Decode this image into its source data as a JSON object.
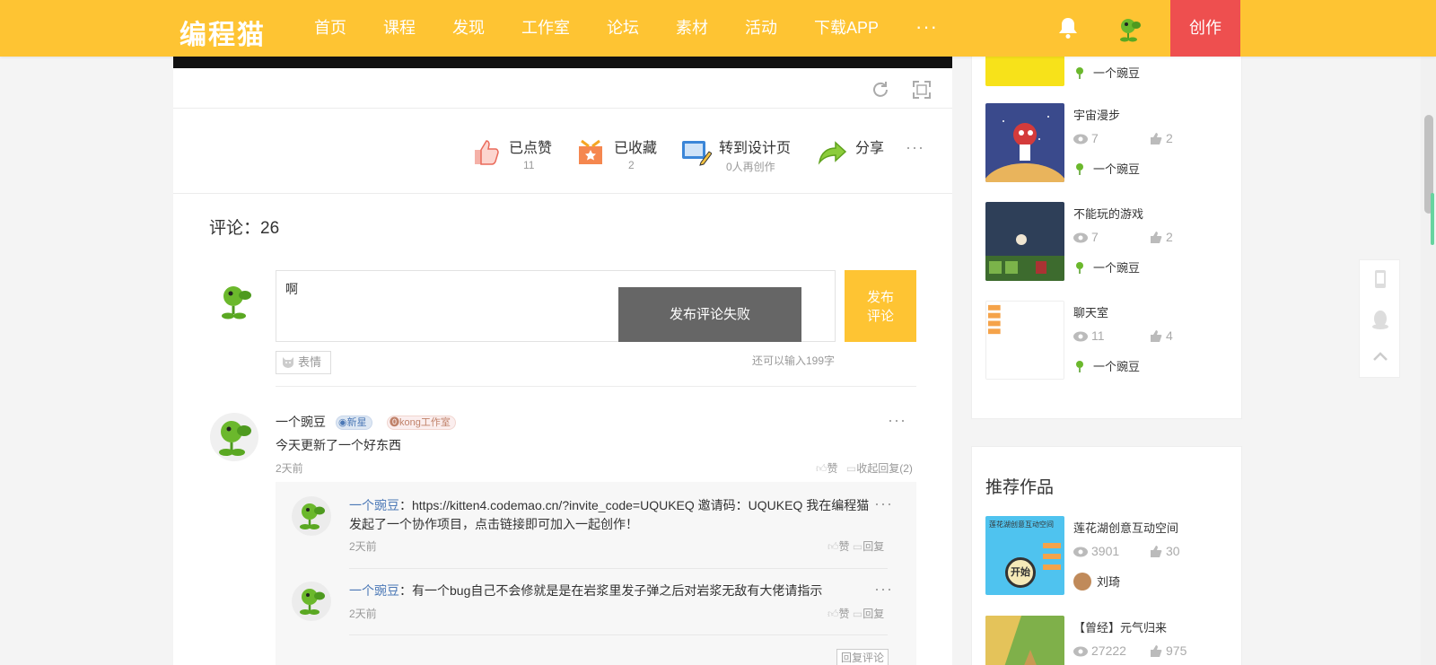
{
  "header": {
    "logo": "编程猫",
    "nav": [
      "首页",
      "课程",
      "发现",
      "工作室",
      "论坛",
      "素材",
      "活动",
      "下载APP"
    ],
    "more": "···",
    "create": "创作",
    "colors": {
      "bar": "#fec433",
      "create": "#ee4f4f"
    }
  },
  "player": {
    "refresh_icon": "refresh-icon",
    "fullscreen_icon": "fullscreen-icon"
  },
  "actions": {
    "like": {
      "label": "已点赞",
      "count": "11"
    },
    "favorite": {
      "label": "已收藏",
      "count": "2"
    },
    "design": {
      "label": "转到设计页",
      "sub": "0人再创作"
    },
    "share": {
      "label": "分享"
    },
    "more": "···"
  },
  "comments": {
    "title": "评论：26",
    "input_value": "啊",
    "publish": [
      "发布",
      "评论"
    ],
    "toast": "发布评论失败",
    "emoji": "表情",
    "counter": "还可以输入199字",
    "items": [
      {
        "name": "一个豌豆",
        "badge_level": "新星",
        "badge_studio": "kong工作室",
        "text": "今天更新了一个好东西",
        "time": "2天前",
        "like": "赞",
        "collapse": "收起回复(2)",
        "more": "···",
        "replies": [
          {
            "name": "一个豌豆",
            "text": "：https://kitten4.codemao.cn/?invite_code=UQUKEQ 邀请码：UQUKEQ 我在编程猫发起了一个协作项目，点击链接即可加入一起创作！",
            "time": "2天前",
            "like": "赞",
            "reply": "回复",
            "more": "···"
          },
          {
            "name": "一个豌豆",
            "text": "：有一个bug自己不会修就是是在岩浆里发子弹之后对岩浆无敌有大佬请指示",
            "time": "2天前",
            "like": "赞",
            "reply": "回复",
            "more": "···"
          }
        ],
        "reply_button": "回复评论"
      }
    ]
  },
  "sidebar": {
    "author_top": "一个豌豆",
    "works": [
      {
        "title": "宇宙漫步",
        "views": "7",
        "likes": "2",
        "author": "一个豌豆"
      },
      {
        "title": "不能玩的游戏",
        "views": "7",
        "likes": "2",
        "author": "一个豌豆"
      },
      {
        "title": "聊天室",
        "views": "11",
        "likes": "4",
        "author": "一个豌豆"
      }
    ],
    "recommend_title": "推荐作品",
    "recommend": [
      {
        "title": "莲花湖创意互动空间",
        "views": "3901",
        "likes": "30",
        "author": "刘琦",
        "thumb_text": "莲花湖创意互动空间",
        "thumb_btn": "开始"
      },
      {
        "title": "【曾经】元气归来",
        "views": "27222",
        "likes": "975"
      }
    ]
  }
}
